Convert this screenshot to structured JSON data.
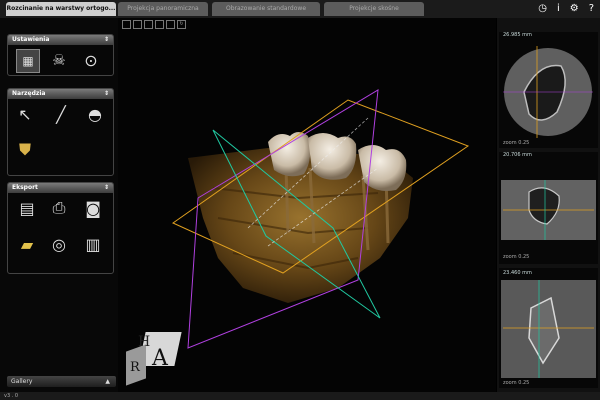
{
  "tabs": {
    "active": "Rozcinanie na warstwy ortogo...",
    "t2": "Projekcja panoramiczna",
    "t3": "Obrazowanie standardowe",
    "t4": "Projekcje skośne"
  },
  "sections": {
    "settings": "Ustawienia",
    "tools": "Narzędzia",
    "export": "Eksport"
  },
  "gallery": "Gallery",
  "slices": [
    {
      "measure": "26.985 mm",
      "zoom": "zoom 0.25",
      "ratio": "1x1"
    },
    {
      "measure": "20.706 mm",
      "zoom": "zoom 0.25",
      "ratio": "1x1"
    },
    {
      "measure": "23.460 mm",
      "zoom": "zoom 0.25",
      "ratio": "1x1"
    }
  ],
  "cube_letters": {
    "front": "A",
    "side": "R",
    "top": "H"
  },
  "status": "v3 . 0"
}
